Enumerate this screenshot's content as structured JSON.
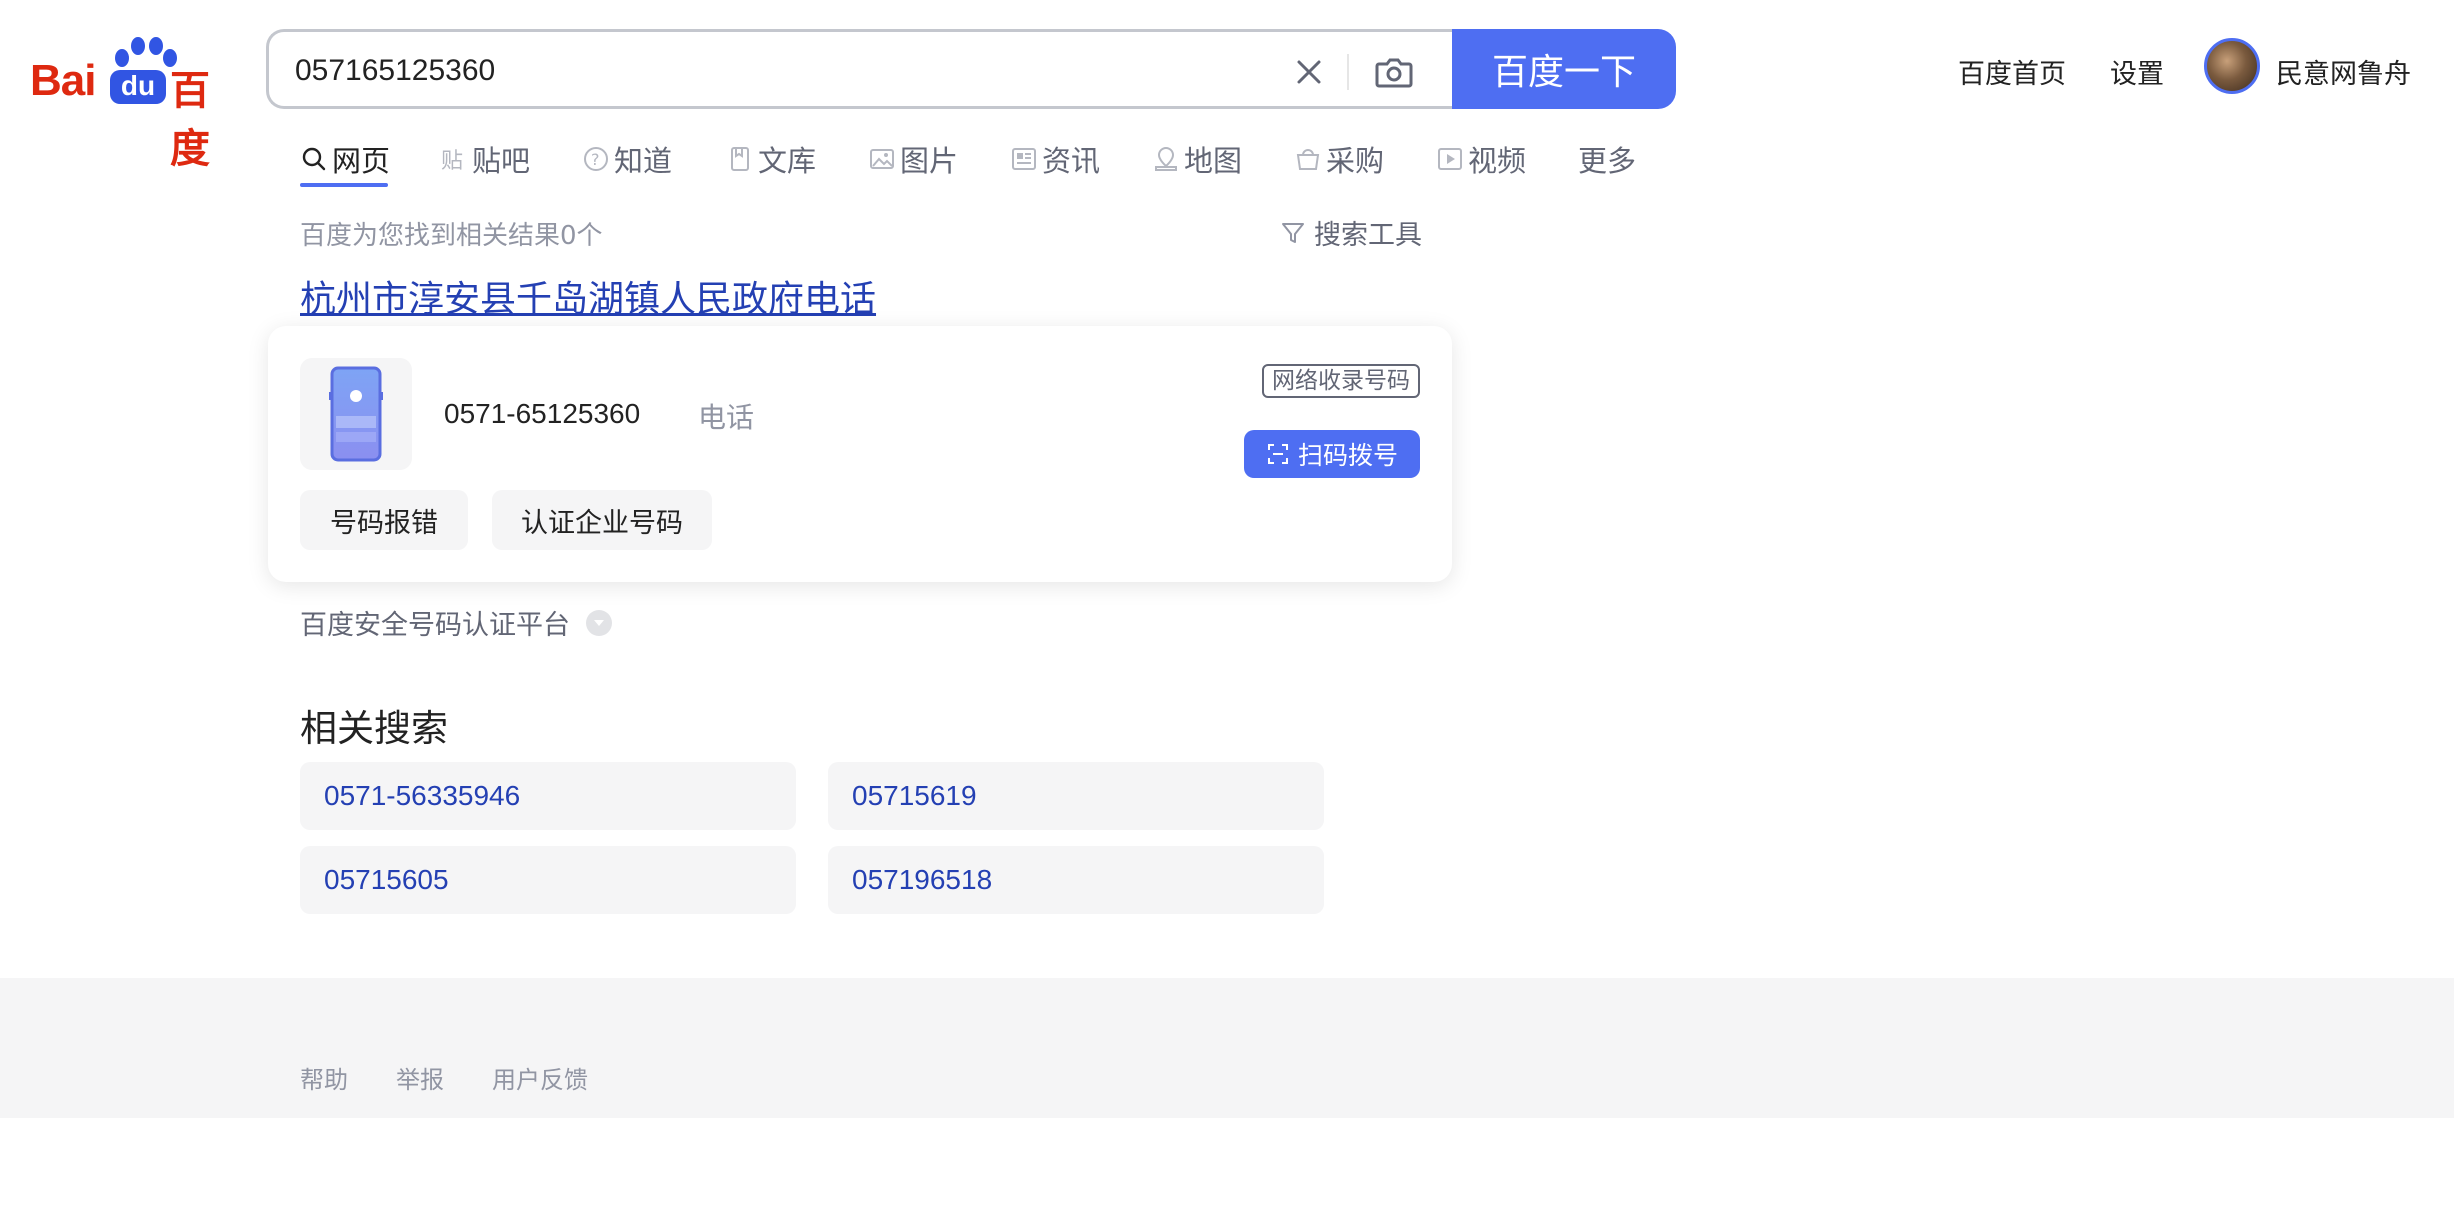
{
  "logo": {
    "latin": "Bai",
    "du": "du",
    "cn": "百度"
  },
  "search": {
    "query": "057165125360",
    "submit_label": "百度一下",
    "button_color": "#4e6ef2"
  },
  "top_links": {
    "home": "百度首页",
    "settings": "设置",
    "username": "民意网鲁舟"
  },
  "tabs": [
    {
      "label": "网页",
      "icon": "search-icon",
      "active": true
    },
    {
      "label": "贴吧",
      "icon": "tieba-icon"
    },
    {
      "label": "知道",
      "icon": "question-icon"
    },
    {
      "label": "文库",
      "icon": "document-icon"
    },
    {
      "label": "图片",
      "icon": "image-icon"
    },
    {
      "label": "资讯",
      "icon": "news-icon"
    },
    {
      "label": "地图",
      "icon": "map-icon"
    },
    {
      "label": "采购",
      "icon": "basket-icon"
    },
    {
      "label": "视频",
      "icon": "video-icon"
    },
    {
      "label": "更多"
    }
  ],
  "results": {
    "count_text": "百度为您找到相关结果0个",
    "tools_label": "搜索工具",
    "title": "杭州市淳安县千岛湖镇人民政府电话"
  },
  "phone_card": {
    "number": "0571-65125360",
    "type": "电话",
    "badge": "网络收录号码",
    "scan_label": "扫码拨号",
    "report_label": "号码报错",
    "verify_label": "认证企业号码"
  },
  "source": {
    "label": "百度安全号码认证平台"
  },
  "related": {
    "title": "相关搜索",
    "items": [
      "0571-56335946",
      "05715619",
      "05715605",
      "057196518"
    ]
  },
  "footer": {
    "help": "帮助",
    "report": "举报",
    "feedback": "用户反馈"
  }
}
